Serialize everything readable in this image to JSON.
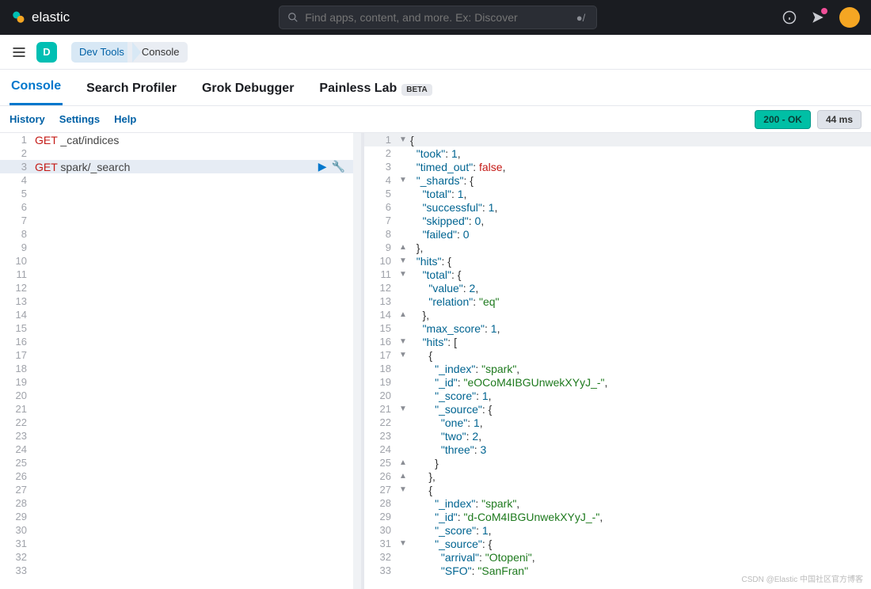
{
  "brand": {
    "name": "elastic"
  },
  "search": {
    "placeholder": "Find apps, content, and more. Ex: Discover",
    "shortcut": "●/"
  },
  "space": {
    "initial": "D"
  },
  "breadcrumbs": [
    "Dev Tools",
    "Console"
  ],
  "tabs": [
    {
      "label": "Console",
      "active": true
    },
    {
      "label": "Search Profiler"
    },
    {
      "label": "Grok Debugger"
    },
    {
      "label": "Painless Lab",
      "badge": "BETA"
    }
  ],
  "toolbar": {
    "history": "History",
    "settings": "Settings",
    "help": "Help",
    "status": "200 - OK",
    "latency": "44 ms"
  },
  "request": {
    "lines": [
      {
        "n": 1,
        "v": "GET",
        "p": " _cat/indices"
      },
      {
        "n": 2
      },
      {
        "n": 3,
        "v": "GET",
        "p": " spark/_search",
        "sel": true
      },
      {
        "n": 4
      },
      {
        "n": 5
      },
      {
        "n": 6
      },
      {
        "n": 7
      },
      {
        "n": 8
      },
      {
        "n": 9
      },
      {
        "n": 10
      },
      {
        "n": 11
      },
      {
        "n": 12
      },
      {
        "n": 13
      },
      {
        "n": 14
      },
      {
        "n": 15
      },
      {
        "n": 16
      },
      {
        "n": 17
      },
      {
        "n": 18
      },
      {
        "n": 19
      },
      {
        "n": 20
      },
      {
        "n": 21
      },
      {
        "n": 22
      },
      {
        "n": 23
      },
      {
        "n": 24
      },
      {
        "n": 25
      },
      {
        "n": 26
      },
      {
        "n": 27
      },
      {
        "n": 28
      },
      {
        "n": 29
      },
      {
        "n": 30
      },
      {
        "n": 31
      },
      {
        "n": 32
      },
      {
        "n": 33
      }
    ]
  },
  "response": {
    "lines": [
      {
        "n": 1,
        "f": "▼",
        "t": [
          [
            "b",
            "{"
          ]
        ],
        "hdr": true
      },
      {
        "n": 2,
        "t": [
          [
            "b",
            "  "
          ],
          [
            "k",
            "\"took\""
          ],
          [
            "b",
            ": "
          ],
          [
            "n",
            "1"
          ],
          [
            "b",
            ","
          ]
        ]
      },
      {
        "n": 3,
        "t": [
          [
            "b",
            "  "
          ],
          [
            "k",
            "\"timed_out\""
          ],
          [
            "b",
            ": "
          ],
          [
            "bool",
            "false"
          ],
          [
            "b",
            ","
          ]
        ]
      },
      {
        "n": 4,
        "f": "▼",
        "t": [
          [
            "b",
            "  "
          ],
          [
            "k",
            "\"_shards\""
          ],
          [
            "b",
            ": {"
          ]
        ]
      },
      {
        "n": 5,
        "t": [
          [
            "b",
            "    "
          ],
          [
            "k",
            "\"total\""
          ],
          [
            "b",
            ": "
          ],
          [
            "n",
            "1"
          ],
          [
            "b",
            ","
          ]
        ]
      },
      {
        "n": 6,
        "t": [
          [
            "b",
            "    "
          ],
          [
            "k",
            "\"successful\""
          ],
          [
            "b",
            ": "
          ],
          [
            "n",
            "1"
          ],
          [
            "b",
            ","
          ]
        ]
      },
      {
        "n": 7,
        "t": [
          [
            "b",
            "    "
          ],
          [
            "k",
            "\"skipped\""
          ],
          [
            "b",
            ": "
          ],
          [
            "n",
            "0"
          ],
          [
            "b",
            ","
          ]
        ]
      },
      {
        "n": 8,
        "t": [
          [
            "b",
            "    "
          ],
          [
            "k",
            "\"failed\""
          ],
          [
            "b",
            ": "
          ],
          [
            "n",
            "0"
          ]
        ]
      },
      {
        "n": 9,
        "f": "▲",
        "t": [
          [
            "b",
            "  },"
          ]
        ]
      },
      {
        "n": 10,
        "f": "▼",
        "t": [
          [
            "b",
            "  "
          ],
          [
            "k",
            "\"hits\""
          ],
          [
            "b",
            ": {"
          ]
        ]
      },
      {
        "n": 11,
        "f": "▼",
        "t": [
          [
            "b",
            "    "
          ],
          [
            "k",
            "\"total\""
          ],
          [
            "b",
            ": {"
          ]
        ]
      },
      {
        "n": 12,
        "t": [
          [
            "b",
            "      "
          ],
          [
            "k",
            "\"value\""
          ],
          [
            "b",
            ": "
          ],
          [
            "n",
            "2"
          ],
          [
            "b",
            ","
          ]
        ]
      },
      {
        "n": 13,
        "t": [
          [
            "b",
            "      "
          ],
          [
            "k",
            "\"relation\""
          ],
          [
            "b",
            ": "
          ],
          [
            "s",
            "\"eq\""
          ]
        ]
      },
      {
        "n": 14,
        "f": "▲",
        "t": [
          [
            "b",
            "    },"
          ]
        ]
      },
      {
        "n": 15,
        "t": [
          [
            "b",
            "    "
          ],
          [
            "k",
            "\"max_score\""
          ],
          [
            "b",
            ": "
          ],
          [
            "n",
            "1"
          ],
          [
            "b",
            ","
          ]
        ]
      },
      {
        "n": 16,
        "f": "▼",
        "t": [
          [
            "b",
            "    "
          ],
          [
            "k",
            "\"hits\""
          ],
          [
            "b",
            ": ["
          ]
        ]
      },
      {
        "n": 17,
        "f": "▼",
        "t": [
          [
            "b",
            "      {"
          ]
        ]
      },
      {
        "n": 18,
        "t": [
          [
            "b",
            "        "
          ],
          [
            "k",
            "\"_index\""
          ],
          [
            "b",
            ": "
          ],
          [
            "s",
            "\"spark\""
          ],
          [
            "b",
            ","
          ]
        ]
      },
      {
        "n": 19,
        "t": [
          [
            "b",
            "        "
          ],
          [
            "k",
            "\"_id\""
          ],
          [
            "b",
            ": "
          ],
          [
            "s",
            "\"eOCoM4IBGUnwekXYyJ_-\""
          ],
          [
            "b",
            ","
          ]
        ]
      },
      {
        "n": 20,
        "t": [
          [
            "b",
            "        "
          ],
          [
            "k",
            "\"_score\""
          ],
          [
            "b",
            ": "
          ],
          [
            "n",
            "1"
          ],
          [
            "b",
            ","
          ]
        ]
      },
      {
        "n": 21,
        "f": "▼",
        "t": [
          [
            "b",
            "        "
          ],
          [
            "k",
            "\"_source\""
          ],
          [
            "b",
            ": {"
          ]
        ]
      },
      {
        "n": 22,
        "t": [
          [
            "b",
            "          "
          ],
          [
            "k",
            "\"one\""
          ],
          [
            "b",
            ": "
          ],
          [
            "n",
            "1"
          ],
          [
            "b",
            ","
          ]
        ]
      },
      {
        "n": 23,
        "t": [
          [
            "b",
            "          "
          ],
          [
            "k",
            "\"two\""
          ],
          [
            "b",
            ": "
          ],
          [
            "n",
            "2"
          ],
          [
            "b",
            ","
          ]
        ]
      },
      {
        "n": 24,
        "t": [
          [
            "b",
            "          "
          ],
          [
            "k",
            "\"three\""
          ],
          [
            "b",
            ": "
          ],
          [
            "n",
            "3"
          ]
        ]
      },
      {
        "n": 25,
        "f": "▲",
        "t": [
          [
            "b",
            "        }"
          ]
        ]
      },
      {
        "n": 26,
        "f": "▲",
        "t": [
          [
            "b",
            "      },"
          ]
        ]
      },
      {
        "n": 27,
        "f": "▼",
        "t": [
          [
            "b",
            "      {"
          ]
        ]
      },
      {
        "n": 28,
        "t": [
          [
            "b",
            "        "
          ],
          [
            "k",
            "\"_index\""
          ],
          [
            "b",
            ": "
          ],
          [
            "s",
            "\"spark\""
          ],
          [
            "b",
            ","
          ]
        ]
      },
      {
        "n": 29,
        "t": [
          [
            "b",
            "        "
          ],
          [
            "k",
            "\"_id\""
          ],
          [
            "b",
            ": "
          ],
          [
            "s",
            "\"d-CoM4IBGUnwekXYyJ_-\""
          ],
          [
            "b",
            ","
          ]
        ]
      },
      {
        "n": 30,
        "t": [
          [
            "b",
            "        "
          ],
          [
            "k",
            "\"_score\""
          ],
          [
            "b",
            ": "
          ],
          [
            "n",
            "1"
          ],
          [
            "b",
            ","
          ]
        ]
      },
      {
        "n": 31,
        "f": "▼",
        "t": [
          [
            "b",
            "        "
          ],
          [
            "k",
            "\"_source\""
          ],
          [
            "b",
            ": {"
          ]
        ]
      },
      {
        "n": 32,
        "t": [
          [
            "b",
            "          "
          ],
          [
            "k",
            "\"arrival\""
          ],
          [
            "b",
            ": "
          ],
          [
            "s",
            "\"Otopeni\""
          ],
          [
            "b",
            ","
          ]
        ]
      },
      {
        "n": 33,
        "t": [
          [
            "b",
            "          "
          ],
          [
            "k",
            "\"SFO\""
          ],
          [
            "b",
            ": "
          ],
          [
            "s",
            "\"SanFran\""
          ]
        ]
      }
    ]
  },
  "watermark": "CSDN @Elastic 中国社区官方博客"
}
